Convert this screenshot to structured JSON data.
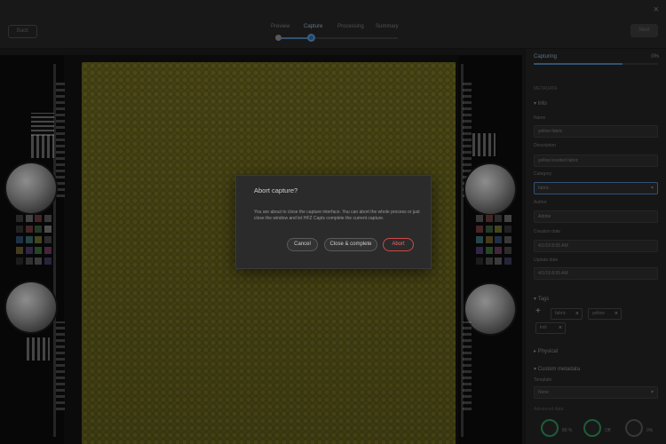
{
  "window": {
    "close_glyph": "×"
  },
  "header": {
    "back_label": "Back",
    "next_label": "Next",
    "steps": [
      {
        "label": "Preview",
        "state": "done"
      },
      {
        "label": "Capture",
        "state": "active"
      },
      {
        "label": "Processing",
        "state": "todo"
      },
      {
        "label": "Summary",
        "state": "todo"
      }
    ]
  },
  "panel": {
    "tab_label": "Capturing",
    "tab_value": "0%",
    "section_title": "METADATA",
    "info_title": "▾ Info",
    "fields": [
      {
        "label": "Name",
        "value": "yellow fabric"
      },
      {
        "label": "Description",
        "value": "yellow knotted fabric"
      },
      {
        "label": "Category",
        "value": "fabric"
      },
      {
        "label": "Author",
        "value": "Adobe"
      },
      {
        "label": "Creation date",
        "value": "4/1/19 8:55 AM"
      },
      {
        "label": "Update date",
        "value": "4/1/19 8:55 AM"
      }
    ],
    "tags_title": "▾ Tags",
    "add_tag_glyph": "+",
    "tags": [
      "fabric",
      "yellow",
      "knit"
    ],
    "tag_remove_glyph": "×",
    "physical_title": "▸ Physical",
    "custom_title": "▾ Custom metadata",
    "template_label": "Template",
    "template_value": "None",
    "next_label": "Advanced data",
    "capture_buttons": [
      {
        "icon": "light-icon",
        "label": "80 %"
      },
      {
        "icon": "mic-icon",
        "label": "Off"
      },
      {
        "icon": "print-icon",
        "label": "0%"
      }
    ]
  },
  "dialog": {
    "title": "Abort capture?",
    "message": "You are about to close the capture interface. You can abort the whole process or just close the window and let HFZ Capts complete the current capture.",
    "cancel_label": "Cancel",
    "close_complete_label": "Close & complete",
    "abort_label": "Abort"
  },
  "colors": {
    "accent": "#4a7fb0",
    "danger": "#d04848",
    "fabric": "#6c6721",
    "capture_green": "#2f8d5a"
  }
}
